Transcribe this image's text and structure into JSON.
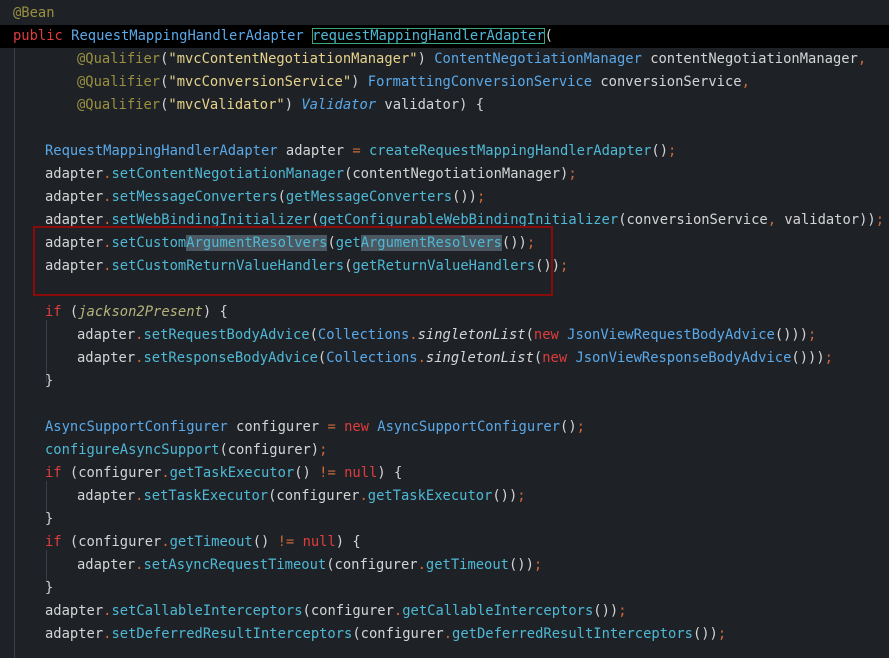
{
  "theme": {
    "background": "#1e2227",
    "current_line": "#000000",
    "text": "#d4d4d4",
    "keyword": "#e03c3c",
    "type": "#5aa8e8",
    "method": "#4fb8d4",
    "string": "#e6d28a",
    "annotation": "#9a8f3f",
    "punctuation": "#cf6a38",
    "italic_field": "#b6b37a",
    "selection_highlight": "#4b5861",
    "annotation_box": "#8b0a0a"
  },
  "code_lines": [
    {
      "indent": 0,
      "tokens": [
        {
          "t": "@Bean",
          "k": "annotation"
        }
      ]
    },
    {
      "indent": 0,
      "current": true,
      "tokens": [
        {
          "t": "public ",
          "k": "keyword"
        },
        {
          "t": "RequestMappingHandlerAdapter",
          "k": "type"
        },
        {
          "t": " ",
          "k": "text"
        },
        {
          "t": "requestMappingHandlerAdapter",
          "k": "method",
          "boxed": true
        },
        {
          "t": "(",
          "k": "text"
        }
      ]
    },
    {
      "indent": 4,
      "tokens": [
        {
          "t": "@Qualifier",
          "k": "annotation"
        },
        {
          "t": "(",
          "k": "text"
        },
        {
          "t": "\"mvcContentNegotiationManager\"",
          "k": "string"
        },
        {
          "t": ") ",
          "k": "text"
        },
        {
          "t": "ContentNegotiationManager",
          "k": "type"
        },
        {
          "t": " contentNegotiationManager",
          "k": "text"
        },
        {
          "t": ",",
          "k": "punct"
        }
      ]
    },
    {
      "indent": 4,
      "tokens": [
        {
          "t": "@Qualifier",
          "k": "annotation"
        },
        {
          "t": "(",
          "k": "text"
        },
        {
          "t": "\"mvcConversionService\"",
          "k": "string"
        },
        {
          "t": ") ",
          "k": "text"
        },
        {
          "t": "FormattingConversionService",
          "k": "type"
        },
        {
          "t": " conversionService",
          "k": "text"
        },
        {
          "t": ",",
          "k": "punct"
        }
      ]
    },
    {
      "indent": 4,
      "tokens": [
        {
          "t": "@Qualifier",
          "k": "annotation"
        },
        {
          "t": "(",
          "k": "text"
        },
        {
          "t": "\"mvcValidator\"",
          "k": "string"
        },
        {
          "t": ") ",
          "k": "text"
        },
        {
          "t": "Validator",
          "k": "type",
          "italic": true
        },
        {
          "t": " validator) {",
          "k": "text"
        }
      ]
    },
    {
      "indent": 0,
      "tokens": []
    },
    {
      "indent": 2,
      "tokens": [
        {
          "t": "RequestMappingHandlerAdapter",
          "k": "type"
        },
        {
          "t": " adapter ",
          "k": "text"
        },
        {
          "t": "=",
          "k": "punct"
        },
        {
          "t": " ",
          "k": "text"
        },
        {
          "t": "createRequestMappingHandlerAdapter",
          "k": "method"
        },
        {
          "t": "()",
          "k": "text"
        },
        {
          "t": ";",
          "k": "punct"
        }
      ]
    },
    {
      "indent": 2,
      "tokens": [
        {
          "t": "adapter",
          "k": "text"
        },
        {
          "t": ".",
          "k": "punct"
        },
        {
          "t": "setContentNegotiationManager",
          "k": "method"
        },
        {
          "t": "(contentNegotiationManager)",
          "k": "text"
        },
        {
          "t": ";",
          "k": "punct"
        }
      ]
    },
    {
      "indent": 2,
      "tokens": [
        {
          "t": "adapter",
          "k": "text"
        },
        {
          "t": ".",
          "k": "punct"
        },
        {
          "t": "setMessageConverters",
          "k": "method"
        },
        {
          "t": "(",
          "k": "text"
        },
        {
          "t": "getMessageConverters",
          "k": "method"
        },
        {
          "t": "())",
          "k": "text"
        },
        {
          "t": ";",
          "k": "punct"
        }
      ]
    },
    {
      "indent": 2,
      "tokens": [
        {
          "t": "adapter",
          "k": "text"
        },
        {
          "t": ".",
          "k": "punct"
        },
        {
          "t": "setWebBindingInitializer",
          "k": "method"
        },
        {
          "t": "(",
          "k": "text"
        },
        {
          "t": "getConfigurableWebBindingInitializer",
          "k": "method"
        },
        {
          "t": "(conversionService",
          "k": "text"
        },
        {
          "t": ",",
          "k": "punct"
        },
        {
          "t": " validator))",
          "k": "text"
        },
        {
          "t": ";",
          "k": "punct"
        }
      ]
    },
    {
      "indent": 2,
      "tokens": [
        {
          "t": "adapter",
          "k": "text"
        },
        {
          "t": ".",
          "k": "punct"
        },
        {
          "t": "setCustom",
          "k": "method"
        },
        {
          "t": "ArgumentResolvers",
          "k": "method",
          "hl": true
        },
        {
          "t": "(",
          "k": "text"
        },
        {
          "t": "get",
          "k": "method"
        },
        {
          "t": "ArgumentResolvers",
          "k": "method",
          "hl": true
        },
        {
          "t": "())",
          "k": "text"
        },
        {
          "t": ";",
          "k": "punct"
        }
      ]
    },
    {
      "indent": 2,
      "tokens": [
        {
          "t": "adapter",
          "k": "text"
        },
        {
          "t": ".",
          "k": "punct"
        },
        {
          "t": "setCustomReturnValueHandlers",
          "k": "method"
        },
        {
          "t": "(",
          "k": "text"
        },
        {
          "t": "getReturnValueHandlers",
          "k": "method"
        },
        {
          "t": "())",
          "k": "text"
        },
        {
          "t": ";",
          "k": "punct"
        }
      ]
    },
    {
      "indent": 0,
      "tokens": []
    },
    {
      "indent": 2,
      "tokens": [
        {
          "t": "if",
          "k": "keyword"
        },
        {
          "t": " (",
          "k": "text"
        },
        {
          "t": "jackson2Present",
          "k": "italic_field",
          "italic": true
        },
        {
          "t": ") {",
          "k": "text"
        }
      ]
    },
    {
      "indent": 4,
      "tokens": [
        {
          "t": "adapter",
          "k": "text"
        },
        {
          "t": ".",
          "k": "punct"
        },
        {
          "t": "setRequestBodyAdvice",
          "k": "method"
        },
        {
          "t": "(",
          "k": "text"
        },
        {
          "t": "Collections",
          "k": "type"
        },
        {
          "t": ".",
          "k": "punct"
        },
        {
          "t": "singletonList",
          "k": "text",
          "italic": true
        },
        {
          "t": "(",
          "k": "text"
        },
        {
          "t": "new",
          "k": "keyword"
        },
        {
          "t": " ",
          "k": "text"
        },
        {
          "t": "JsonViewRequestBodyAdvice",
          "k": "type"
        },
        {
          "t": "()))",
          "k": "text"
        },
        {
          "t": ";",
          "k": "punct"
        }
      ]
    },
    {
      "indent": 4,
      "tokens": [
        {
          "t": "adapter",
          "k": "text"
        },
        {
          "t": ".",
          "k": "punct"
        },
        {
          "t": "setResponseBodyAdvice",
          "k": "method"
        },
        {
          "t": "(",
          "k": "text"
        },
        {
          "t": "Collections",
          "k": "type"
        },
        {
          "t": ".",
          "k": "punct"
        },
        {
          "t": "singletonList",
          "k": "text",
          "italic": true
        },
        {
          "t": "(",
          "k": "text"
        },
        {
          "t": "new",
          "k": "keyword"
        },
        {
          "t": " ",
          "k": "text"
        },
        {
          "t": "JsonViewResponseBodyAdvice",
          "k": "type"
        },
        {
          "t": "()))",
          "k": "text"
        },
        {
          "t": ";",
          "k": "punct"
        }
      ]
    },
    {
      "indent": 2,
      "tokens": [
        {
          "t": "}",
          "k": "text"
        }
      ]
    },
    {
      "indent": 0,
      "tokens": []
    },
    {
      "indent": 2,
      "tokens": [
        {
          "t": "AsyncSupportConfigurer",
          "k": "type"
        },
        {
          "t": " configurer ",
          "k": "text"
        },
        {
          "t": "=",
          "k": "punct"
        },
        {
          "t": " ",
          "k": "text"
        },
        {
          "t": "new",
          "k": "keyword"
        },
        {
          "t": " ",
          "k": "text"
        },
        {
          "t": "AsyncSupportConfigurer",
          "k": "type"
        },
        {
          "t": "()",
          "k": "text"
        },
        {
          "t": ";",
          "k": "punct"
        }
      ]
    },
    {
      "indent": 2,
      "tokens": [
        {
          "t": "configureAsyncSupport",
          "k": "method"
        },
        {
          "t": "(configurer)",
          "k": "text"
        },
        {
          "t": ";",
          "k": "punct"
        }
      ]
    },
    {
      "indent": 2,
      "tokens": [
        {
          "t": "if",
          "k": "keyword"
        },
        {
          "t": " (configurer",
          "k": "text"
        },
        {
          "t": ".",
          "k": "punct"
        },
        {
          "t": "getTaskExecutor",
          "k": "method"
        },
        {
          "t": "() ",
          "k": "text"
        },
        {
          "t": "!=",
          "k": "punct"
        },
        {
          "t": " ",
          "k": "text"
        },
        {
          "t": "null",
          "k": "keyword"
        },
        {
          "t": ") {",
          "k": "text"
        }
      ]
    },
    {
      "indent": 4,
      "tokens": [
        {
          "t": "adapter",
          "k": "text"
        },
        {
          "t": ".",
          "k": "punct"
        },
        {
          "t": "setTaskExecutor",
          "k": "method"
        },
        {
          "t": "(configurer",
          "k": "text"
        },
        {
          "t": ".",
          "k": "punct"
        },
        {
          "t": "getTaskExecutor",
          "k": "method"
        },
        {
          "t": "())",
          "k": "text"
        },
        {
          "t": ";",
          "k": "punct"
        }
      ]
    },
    {
      "indent": 2,
      "tokens": [
        {
          "t": "}",
          "k": "text"
        }
      ]
    },
    {
      "indent": 2,
      "tokens": [
        {
          "t": "if",
          "k": "keyword"
        },
        {
          "t": " (configurer",
          "k": "text"
        },
        {
          "t": ".",
          "k": "punct"
        },
        {
          "t": "getTimeout",
          "k": "method"
        },
        {
          "t": "() ",
          "k": "text"
        },
        {
          "t": "!=",
          "k": "punct"
        },
        {
          "t": " ",
          "k": "text"
        },
        {
          "t": "null",
          "k": "keyword"
        },
        {
          "t": ") {",
          "k": "text"
        }
      ]
    },
    {
      "indent": 4,
      "tokens": [
        {
          "t": "adapter",
          "k": "text"
        },
        {
          "t": ".",
          "k": "punct"
        },
        {
          "t": "setAsyncRequestTimeout",
          "k": "method"
        },
        {
          "t": "(configurer",
          "k": "text"
        },
        {
          "t": ".",
          "k": "punct"
        },
        {
          "t": "getTimeout",
          "k": "method"
        },
        {
          "t": "())",
          "k": "text"
        },
        {
          "t": ";",
          "k": "punct"
        }
      ]
    },
    {
      "indent": 2,
      "tokens": [
        {
          "t": "}",
          "k": "text"
        }
      ]
    },
    {
      "indent": 2,
      "tokens": [
        {
          "t": "adapter",
          "k": "text"
        },
        {
          "t": ".",
          "k": "punct"
        },
        {
          "t": "setCallableInterceptors",
          "k": "method"
        },
        {
          "t": "(configurer",
          "k": "text"
        },
        {
          "t": ".",
          "k": "punct"
        },
        {
          "t": "getCallableInterceptors",
          "k": "method"
        },
        {
          "t": "())",
          "k": "text"
        },
        {
          "t": ";",
          "k": "punct"
        }
      ]
    },
    {
      "indent": 2,
      "tokens": [
        {
          "t": "adapter",
          "k": "text"
        },
        {
          "t": ".",
          "k": "punct"
        },
        {
          "t": "setDeferredResultInterceptors",
          "k": "method"
        },
        {
          "t": "(configurer",
          "k": "text"
        },
        {
          "t": ".",
          "k": "punct"
        },
        {
          "t": "getDeferredResultInterceptors",
          "k": "method"
        },
        {
          "t": "())",
          "k": "text"
        },
        {
          "t": ";",
          "k": "punct"
        }
      ]
    }
  ]
}
